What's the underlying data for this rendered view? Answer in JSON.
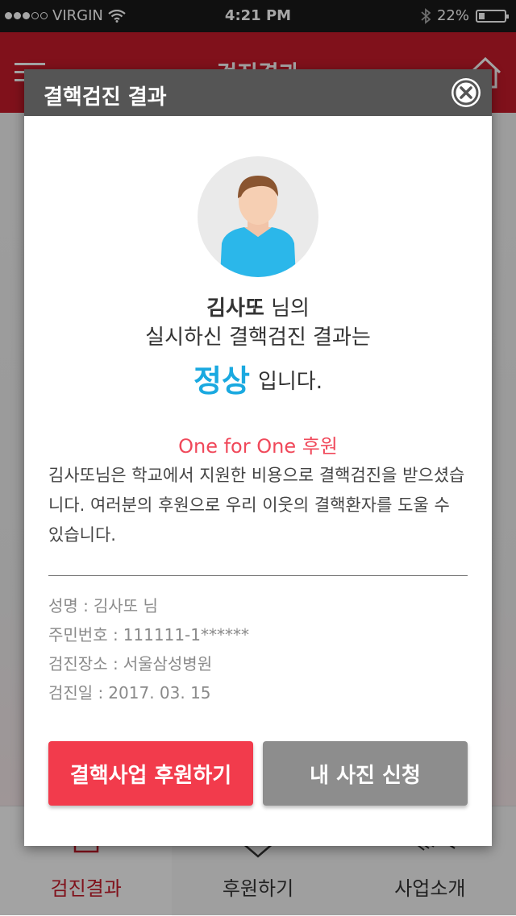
{
  "status_bar": {
    "carrier": "VIRGIN",
    "time": "4:21 PM",
    "battery": "22%",
    "battery_level": 0.22
  },
  "header": {
    "title": "검진결과"
  },
  "tabs": [
    {
      "label": "검진결과",
      "active": true
    },
    {
      "label": "후원하기",
      "active": false
    },
    {
      "label": "사업소개",
      "active": false
    }
  ],
  "modal": {
    "title": "결핵검진 결과",
    "user_name": "김사또",
    "user_suffix": "님의",
    "line2": "실시하신 결핵검진 결과는",
    "result": "정상",
    "result_suffix": "입니다.",
    "sponsor_title": "One for One 후원",
    "description": "김사또님은 학교에서 지원한 비용으로 결핵검진을 받으셨습니다. 여러분의 후원으로 우리 이웃의 결핵환자를 도울 수 있습니다.",
    "info": {
      "name_label": "성명 :",
      "name_value": "김사또 님",
      "id_label": "주민번호 :",
      "id_value": "111111-1******",
      "place_label": "검진장소 :",
      "place_value": "서울삼성병원",
      "date_label": "검진일 :",
      "date_value": "2017. 03. 15"
    },
    "buttons": {
      "sponsor": "결핵사업 후원하기",
      "photo": "내 사진 신청"
    }
  },
  "colors": {
    "brand_red": "#c51b2a",
    "result_blue": "#1aa9e0",
    "sponsor_button": "#f23b4c",
    "photo_button": "#8d8d8d"
  }
}
